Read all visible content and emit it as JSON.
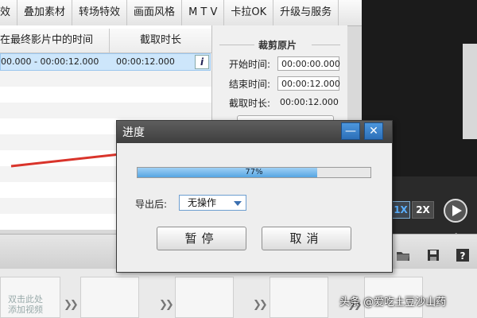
{
  "menu": [
    "效",
    "叠加素材",
    "转场特效",
    "画面风格",
    "M T V",
    "卡拉OK",
    "升级与服务"
  ],
  "table": {
    "col1": "在最终影片中的时间",
    "col2": "截取时长",
    "row": {
      "range": "00.000 - 00:00:12.000",
      "duration": "00:00:12.000",
      "info": "i"
    }
  },
  "clip": {
    "title": "裁剪原片",
    "start_label": "开始时间:",
    "start_value": "00:00:00.000",
    "end_label": "结束时间:",
    "end_value": "00:00:12.000",
    "dur_label": "截取时长:",
    "dur_value": "00:00:12.000"
  },
  "player": {
    "speed_1x": "1X",
    "speed_2x": "2X"
  },
  "dialog": {
    "title": "进度",
    "minimize": "—",
    "close": "✕",
    "progress_percent": 77,
    "progress_text": "77%",
    "after_label": "导出后:",
    "after_value": "无操作",
    "pause": "暂停",
    "cancel": "取消"
  },
  "strip": {
    "hint_line1": "双击此处",
    "hint_line2": "添加视频"
  },
  "watermark": "头条 @爱吃土豆沙山药",
  "colors": {
    "arrow": "#d9342b",
    "progress": "#56a5e2",
    "titlebar": "#4a4a4a",
    "window_btn": "#2c6fb8"
  }
}
